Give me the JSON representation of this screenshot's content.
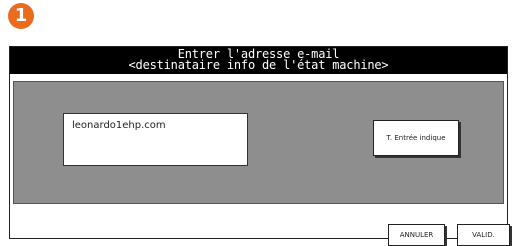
{
  "step": {
    "number": "1"
  },
  "dialog": {
    "title_line1": "Entrer l'adresse e-mail",
    "title_line2": "<destinataire info de l'état machine>"
  },
  "email": {
    "value": "leonardo1ehp.com"
  },
  "buttons": {
    "text_entry": "T. Entrée indique",
    "cancel": "ANNULER",
    "valid": "VALID."
  },
  "colors": {
    "badge": "#ea6a1e",
    "title_bar": "#000000",
    "gray_area": "#8e8e8e"
  },
  "icons": {
    "step_badge": "circled-number-1"
  }
}
